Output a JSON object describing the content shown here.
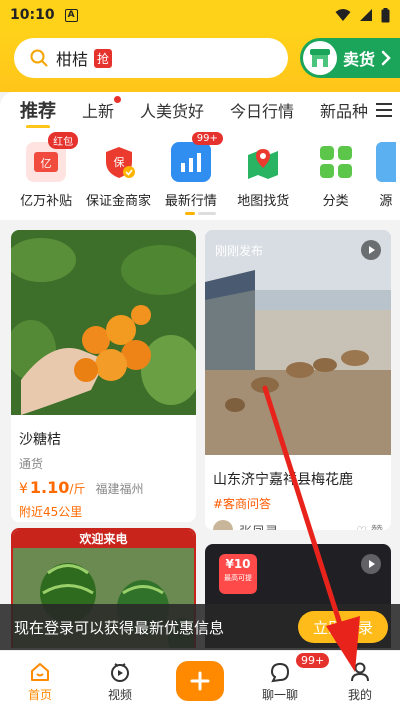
{
  "status": {
    "time": "10:10",
    "a_icon": "A"
  },
  "search": {
    "text": "柑桔",
    "hot_badge": "抢"
  },
  "sell_button": {
    "label": "卖货"
  },
  "tabs": [
    "推荐",
    "上新",
    "人美货好",
    "今日行情",
    "新品种植"
  ],
  "shortcuts": [
    {
      "label": "亿万补贴",
      "badge": "红包"
    },
    {
      "label": "保证金商家",
      "badge": ""
    },
    {
      "label": "最新行情",
      "badge": "99+"
    },
    {
      "label": "地图找货",
      "badge": ""
    },
    {
      "label": "分类",
      "badge": ""
    },
    {
      "label": "源",
      "badge": ""
    }
  ],
  "cards": {
    "card1": {
      "title": "沙糖桔",
      "sub": "通货",
      "currency": "¥",
      "price": "1.10",
      "unit": "/斤",
      "location": "福建福州",
      "near": "附近45公里"
    },
    "card2": {
      "overlay": "刚刚发布",
      "title": "山东济宁嘉祥县梅花鹿",
      "tag": "#客商问答",
      "user": "张凤灵",
      "like": "赞"
    },
    "card3": {
      "banner": "欢迎来电"
    },
    "card4": {
      "price_tag": "¥10",
      "price_sub": "最高可提"
    }
  },
  "toast": {
    "text": "现在登录可以获得最新优惠信息",
    "button": "立即登录"
  },
  "bottom_nav": [
    {
      "label": "首页"
    },
    {
      "label": "视频"
    },
    {
      "label": ""
    },
    {
      "label": "聊一聊",
      "badge": "99+"
    },
    {
      "label": "我的"
    }
  ],
  "colors": {
    "brand_yellow": "#ffd21a",
    "accent_orange": "#ff8a00",
    "price_orange": "#ff6a00",
    "sell_green": "#1aa55a",
    "alert_red": "#e6322d"
  }
}
